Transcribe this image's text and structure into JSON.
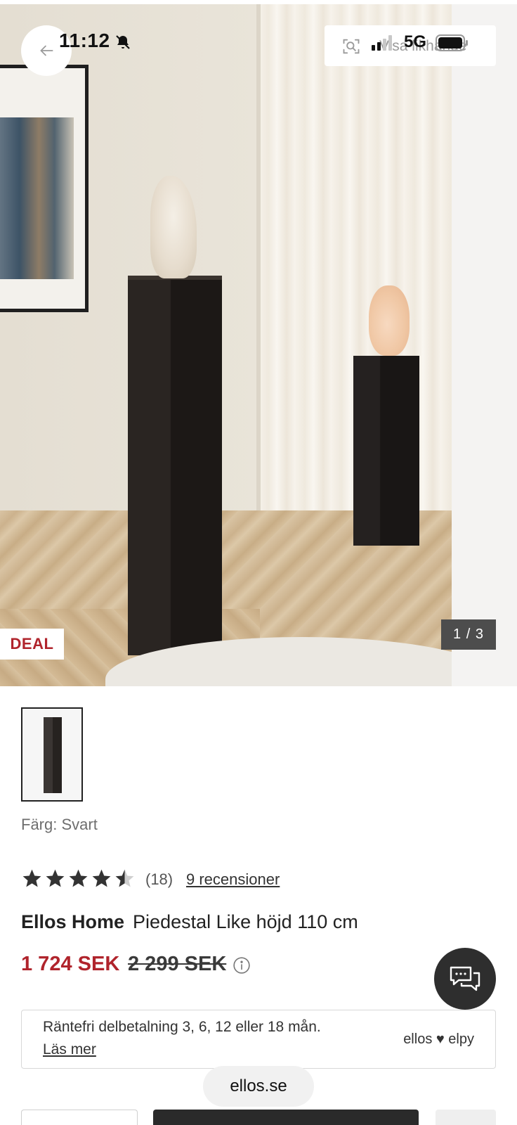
{
  "status_bar": {
    "time": "11:12",
    "network": "5G",
    "icons": [
      "bell-muted-icon",
      "signal-icon",
      "battery-icon"
    ]
  },
  "hero": {
    "back_icon": "arrow-left-icon",
    "top_pill_label": "Visa likhande",
    "top_pill_icon": "visual-search-icon",
    "deal_badge": "DEAL",
    "counter": "1 / 3"
  },
  "product": {
    "color_label": "Färg: Svart",
    "rating": 4.5,
    "rating_max": 5,
    "rating_count": "(18)",
    "reviews_link": "9 recensioner",
    "brand": "Ellos Home",
    "name": "Piedestal Like höjd 110 cm",
    "price_now": "1 724 SEK",
    "price_old": "2 299 SEK",
    "price_color": "#b0242c"
  },
  "finance": {
    "text": "Räntefri delbetalning 3, 6, 12 eller 18 mån.",
    "link": "Läs mer",
    "logo": "ellos ♥ elpy"
  },
  "browser": {
    "url": "ellos.se"
  },
  "chat": {
    "icon": "chat-bubbles-icon"
  }
}
